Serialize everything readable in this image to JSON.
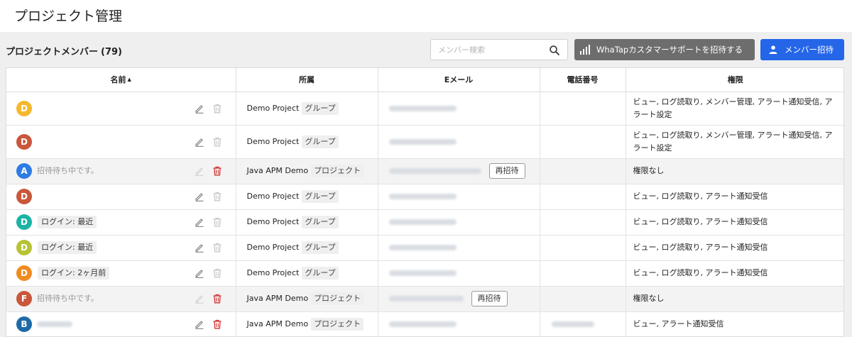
{
  "page": {
    "title": "プロジェクト管理"
  },
  "section": {
    "title": "プロジェクトメンバー",
    "count": "(79)"
  },
  "search": {
    "placeholder": "メンバー検索",
    "value": ""
  },
  "buttons": {
    "support": "WhaTapカスタマーサポートを招待する",
    "invite": "メンバー招待"
  },
  "colors": {
    "invite_button": "#2566e8",
    "support_button": "#6d6d6d",
    "delete_active": "#d32f2f"
  },
  "table": {
    "headers": {
      "name": "名前",
      "name_sort": "▲",
      "affiliation": "所属",
      "email": "Eメール",
      "phone": "電話番号",
      "permission": "権限"
    },
    "rows": [
      {
        "avatar": "D",
        "avatar_color": "#f5b82e",
        "name": "",
        "login": "",
        "affiliation": "Demo Project",
        "aff_type": "グループ",
        "reinvite": "",
        "permission": "ビュー, ログ読取り, メンバー管理, アラート通知受信, アラート設定"
      },
      {
        "avatar": "D",
        "avatar_color": "#c9573b",
        "name": "",
        "login": "",
        "affiliation": "Demo Project",
        "aff_type": "グループ",
        "reinvite": "",
        "permission": "ビュー, ログ読取り, メンバー管理, アラート通知受信, アラート設定"
      },
      {
        "avatar": "A",
        "avatar_color": "#2d7be5",
        "name": "招待待ち中です。",
        "login": "",
        "affiliation": "Java APM Demo",
        "aff_type": "プロジェクト",
        "reinvite": "再招待",
        "permission": "権限なし"
      },
      {
        "avatar": "D",
        "avatar_color": "#c9573b",
        "name": "",
        "login": "",
        "affiliation": "Demo Project",
        "aff_type": "グループ",
        "reinvite": "",
        "permission": "ビュー, ログ読取り, アラート通知受信"
      },
      {
        "avatar": "D",
        "avatar_color": "#1ab3a6",
        "name": "",
        "login": "ログイン: 最近",
        "affiliation": "Demo Project",
        "aff_type": "グループ",
        "reinvite": "",
        "permission": "ビュー, ログ読取り, アラート通知受信"
      },
      {
        "avatar": "D",
        "avatar_color": "#b5c334",
        "name": "",
        "login": "ログイン: 最近",
        "affiliation": "Demo Project",
        "aff_type": "グループ",
        "reinvite": "",
        "permission": "ビュー, ログ読取り, アラート通知受信"
      },
      {
        "avatar": "D",
        "avatar_color": "#f08b1f",
        "name": "",
        "login": "ログイン: 2ヶ月前",
        "affiliation": "Demo Project",
        "aff_type": "グループ",
        "reinvite": "",
        "permission": "ビュー, ログ読取り, アラート通知受信"
      },
      {
        "avatar": "F",
        "avatar_color": "#c9573b",
        "name": "招待待ち中です。",
        "login": "",
        "affiliation": "Java APM Demo",
        "aff_type": "プロジェクト",
        "reinvite": "再招待",
        "permission": "権限なし"
      },
      {
        "avatar": "B",
        "avatar_color": "#1f6aa8",
        "name": "",
        "login": "",
        "affiliation": "Java APM Demo",
        "aff_type": "プロジェクト",
        "reinvite": "",
        "permission": "ビュー, アラート通知受信"
      }
    ]
  }
}
